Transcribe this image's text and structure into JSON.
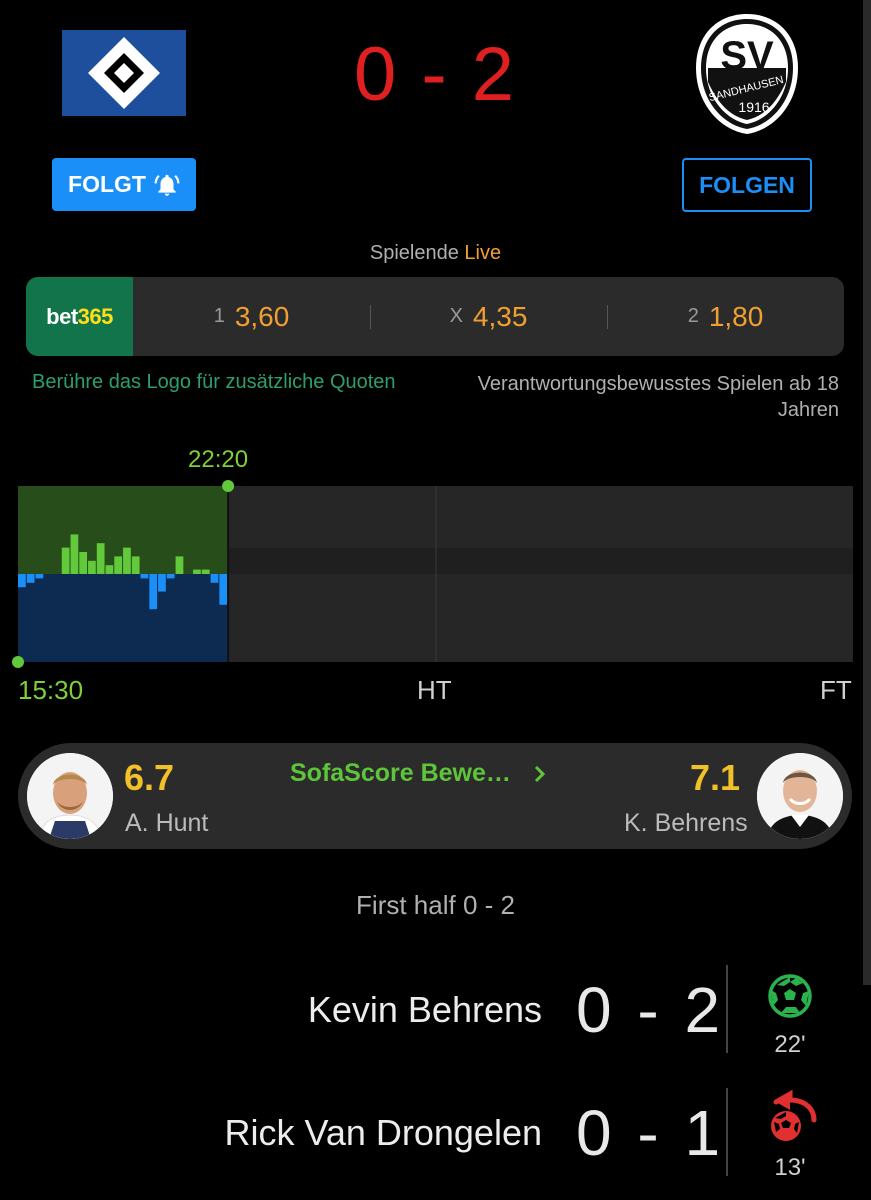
{
  "header": {
    "home_logo": "hsv-diamond-logo",
    "away_logo": "sv-sandhausen-logo",
    "away_logo_text": {
      "top": "SV",
      "ring": "SANDHAUSEN",
      "year": "1916"
    },
    "score": "0 - 2",
    "score_color": "#e02020"
  },
  "follow": {
    "home_label": "FOLGT",
    "away_label": "FOLGEN",
    "accent": "#1a8ff7"
  },
  "status": {
    "label": "Spielende",
    "live": "Live"
  },
  "odds": {
    "brand_left": "bet",
    "brand_right": "365",
    "items": [
      {
        "label": "1",
        "value": "3,60"
      },
      {
        "label": "X",
        "value": "4,35"
      },
      {
        "label": "2",
        "value": "1,80"
      }
    ],
    "hint_left": "Berühre das Logo für zusätzliche Quoten",
    "hint_right": "Verantwortungsbewusstes Spielen ab 18 Jahren"
  },
  "momentum": {
    "current_time": "22:20",
    "start": "15:30",
    "half": "HT",
    "end": "FT",
    "minute_now": 22,
    "home_color": "#62c93b",
    "away_color": "#1a8ff7",
    "bars": [
      -0.15,
      -0.1,
      -0.05,
      0,
      0,
      0.3,
      0.45,
      0.25,
      0.15,
      0.35,
      0.1,
      0.2,
      0.3,
      0.2,
      -0.05,
      -0.4,
      -0.2,
      -0.05,
      0.2,
      0,
      0.05,
      0.05,
      -0.1,
      -0.35
    ]
  },
  "ratings": {
    "home_rating": "6.7",
    "home_player": "A. Hunt",
    "away_rating": "7.1",
    "away_player": "K. Behrens",
    "link": "SofaScore Bewe…"
  },
  "half_label": "First half 0 - 2",
  "events": [
    {
      "player": "Kevin Behrens",
      "score": "0 - 2",
      "minute": "22'",
      "icon": "football-goal-icon"
    },
    {
      "player": "Rick Van Drongelen",
      "score": "0 - 1",
      "minute": "13'",
      "icon": "own-goal-icon"
    }
  ]
}
